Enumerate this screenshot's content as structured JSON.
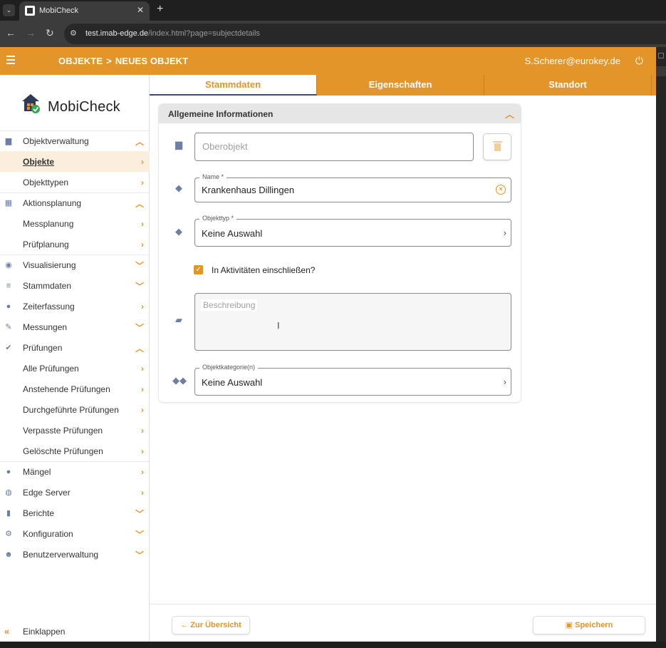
{
  "browser": {
    "tab_title": "MobiCheck",
    "tab_close": "✕",
    "new_tab": "+",
    "url_host": "test.imab-edge.de",
    "url_path": "/index.html?page=subjectdetails"
  },
  "header": {
    "crumb_root": "OBJEKTE",
    "crumb_sep": ">",
    "crumb_current": "NEUES OBJEKT",
    "user": "S.Scherer@eurokey.de"
  },
  "logo": {
    "text": "MobiCheck"
  },
  "sidebar": {
    "items": [
      {
        "label": "Objektverwaltung",
        "icon": "building-icon",
        "chev": "^"
      },
      {
        "label": "Objekte",
        "chev": ">"
      },
      {
        "label": "Objekttypen",
        "chev": ">"
      },
      {
        "label": "Aktionsplanung",
        "icon": "calendar-icon",
        "chev": "^"
      },
      {
        "label": "Messplanung",
        "chev": ">"
      },
      {
        "label": "Prüfplanung",
        "chev": ">"
      },
      {
        "label": "Visualisierung",
        "icon": "eye-icon",
        "chev": "v"
      },
      {
        "label": "Stammdaten",
        "icon": "list-icon",
        "chev": "v"
      },
      {
        "label": "Zeiterfassung",
        "icon": "clock-icon",
        "chev": ">"
      },
      {
        "label": "Messungen",
        "icon": "ruler-icon",
        "chev": "v"
      },
      {
        "label": "Prüfungen",
        "icon": "check-circle-icon",
        "chev": "^"
      },
      {
        "label": "Alle Prüfungen",
        "chev": ">"
      },
      {
        "label": "Anstehende Prüfungen",
        "chev": ">"
      },
      {
        "label": "Durchgeführte Prüfungen",
        "chev": ">"
      },
      {
        "label": "Verpasste Prüfungen",
        "chev": ">"
      },
      {
        "label": "Gelöschte Prüfungen",
        "chev": ">"
      },
      {
        "label": "Mängel",
        "icon": "info-icon",
        "chev": ">"
      },
      {
        "label": "Edge Server",
        "icon": "globe-icon",
        "chev": ">"
      },
      {
        "label": "Berichte",
        "icon": "document-icon",
        "chev": "v"
      },
      {
        "label": "Konfiguration",
        "icon": "gears-icon",
        "chev": "v"
      },
      {
        "label": "Benutzerverwaltung",
        "icon": "users-icon",
        "chev": "v"
      }
    ],
    "collapse_label": "Einklappen"
  },
  "tabs": [
    {
      "label": "Stammdaten"
    },
    {
      "label": "Eigenschaften"
    },
    {
      "label": "Standort"
    }
  ],
  "card": {
    "title": "Allgemeine Informationen",
    "oberobjekt_placeholder": "Oberobjekt",
    "name_label": "Name *",
    "name_value": "Krankenhaus Dillingen",
    "objekttyp_label": "Objekttyp *",
    "objekttyp_value": "Keine Auswahl",
    "checkbox_label": "In Aktivitäten einschließen?",
    "beschreibung_placeholder": "Beschreibung",
    "kategorie_label": "Objektkategorie(n)",
    "kategorie_value": "Keine Auswahl"
  },
  "footer": {
    "back_label": "← Zur Übersicht",
    "save_label": "Speichern"
  },
  "colors": {
    "accent": "#e3952a",
    "icon": "#6d7fa5",
    "active_row": "#fbeedd"
  }
}
